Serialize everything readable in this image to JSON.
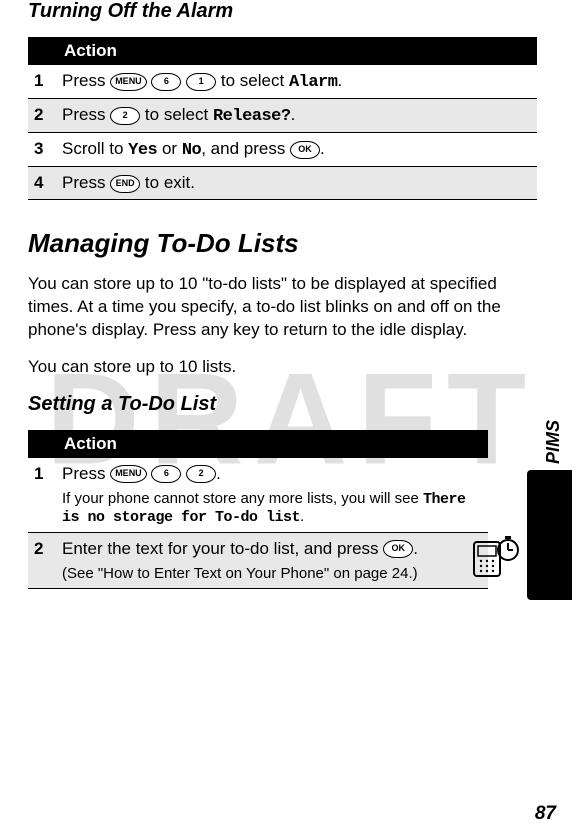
{
  "watermark": "DRAFT",
  "section1": {
    "title": "Turning Off the Alarm",
    "tableHeader": "Action",
    "steps": [
      {
        "num": "1",
        "pre": "Press ",
        "keys": [
          "MENU",
          "6",
          "1"
        ],
        "post1": " to select ",
        "ocr": "Alarm",
        "post2": "."
      },
      {
        "num": "2",
        "pre": "Press ",
        "keys": [
          "2"
        ],
        "post1": " to select ",
        "ocr": "Release?",
        "post2": "."
      },
      {
        "num": "3",
        "pre": "Scroll to ",
        "ocr1": "Yes",
        "mid": " or ",
        "ocr2": "No",
        "post1": ", and press ",
        "keys": [
          "OK"
        ],
        "post2": "."
      },
      {
        "num": "4",
        "pre": "Press ",
        "keys": [
          "END"
        ],
        "post1": " to exit.",
        "ocr": "",
        "post2": ""
      }
    ]
  },
  "section2": {
    "title": "Managing To-Do Lists",
    "para1": "You can store up to 10 \"to-do lists\" to be displayed at specified times. At a time you specify, a to-do list blinks on and off on the phone's display. Press any key to return to the idle display.",
    "para2": "You can store up to 10 lists.",
    "subTitle": "Setting a To-Do List",
    "tableHeader": "Action",
    "steps": [
      {
        "num": "1",
        "pre": "Press ",
        "keys": [
          "MENU",
          "6",
          "2"
        ],
        "post1": ".",
        "sub1": "If your phone cannot store any more lists, you will see ",
        "ocr": "There is no storage for To-do list",
        "sub2": "."
      },
      {
        "num": "2",
        "pre": "Enter the text for your to-do list, and press ",
        "keys": [
          "OK"
        ],
        "post1": ".",
        "sub1": "(See \"How to Enter Text on Your Phone\" on page 24.)"
      }
    ]
  },
  "sidebarLabel": "PIMS",
  "pageNumber": "87"
}
